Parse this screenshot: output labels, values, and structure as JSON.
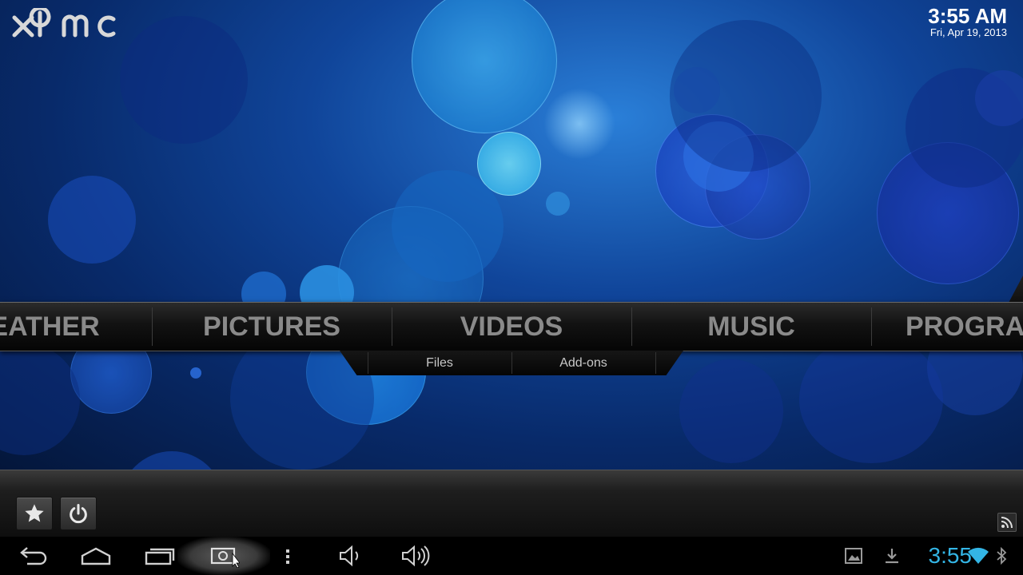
{
  "app": {
    "logo_text": "xbmc"
  },
  "clock": {
    "time": "3:55 AM",
    "date": "Fri, Apr 19, 2013"
  },
  "main_menu": {
    "items": [
      {
        "label": "WEATHER"
      },
      {
        "label": "PICTURES"
      },
      {
        "label": "VIDEOS",
        "selected": true
      },
      {
        "label": "MUSIC"
      },
      {
        "label": "PROGRAMS"
      }
    ]
  },
  "submenu": {
    "items": [
      {
        "label": "Files"
      },
      {
        "label": "Add-ons"
      }
    ]
  },
  "footer": {
    "buttons": [
      {
        "icon": "star-icon",
        "name": "favourites"
      },
      {
        "icon": "power-icon",
        "name": "power"
      }
    ],
    "rss_icon": "rss-icon"
  },
  "system_bar": {
    "time": "3:55",
    "accent_color": "#33b5e5",
    "buttons": [
      "back-icon",
      "home-icon",
      "recent-apps-icon",
      "screenshot-icon",
      "menu-dots-icon",
      "volume-down-icon",
      "volume-up-icon"
    ],
    "status_icons": [
      "gallery-icon",
      "download-icon",
      "wifi-icon",
      "bluetooth-icon"
    ]
  }
}
